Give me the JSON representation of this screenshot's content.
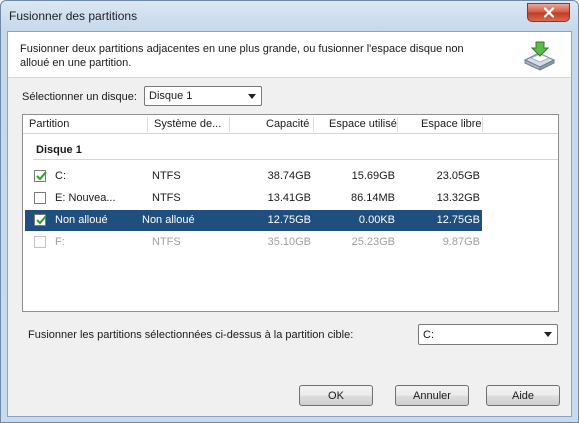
{
  "window": {
    "title": "Fusionner des partitions"
  },
  "header": {
    "description": "Fusionner deux partitions adjacentes en une plus grande, ou fusionner l'espace disque non alloué en une partition."
  },
  "disk_selector": {
    "label": "Sélectionner un disque:",
    "value": "Disque 1"
  },
  "table": {
    "columns": [
      "Partition",
      "Système de...",
      "Capacité",
      "Espace utilisé",
      "Espace libre"
    ],
    "group": "Disque 1",
    "rows": [
      {
        "checked": true,
        "name": "C:",
        "fs": "NTFS",
        "capacity": "38.74GB",
        "used": "15.69GB",
        "free": "23.05GB",
        "state": "normal"
      },
      {
        "checked": false,
        "name": "E: Nouvea...",
        "fs": "NTFS",
        "capacity": "13.41GB",
        "used": "86.14MB",
        "free": "13.32GB",
        "state": "normal"
      },
      {
        "checked": true,
        "name": "Non alloué",
        "fs": "Non alloué",
        "capacity": "12.75GB",
        "used": "0.00KB",
        "free": "12.75GB",
        "state": "selected"
      },
      {
        "checked": false,
        "name": "F:",
        "fs": "NTFS",
        "capacity": "35.10GB",
        "used": "25.23GB",
        "free": "9.87GB",
        "state": "disabled"
      }
    ]
  },
  "target": {
    "label": "Fusionner les partitions sélectionnées ci-dessus à la partition cible:",
    "value": "C:"
  },
  "buttons": {
    "ok": "OK",
    "cancel": "Annuler",
    "help": "Aide"
  },
  "colors": {
    "selection": "#1e4f7f",
    "check": "#2e9e2e"
  }
}
